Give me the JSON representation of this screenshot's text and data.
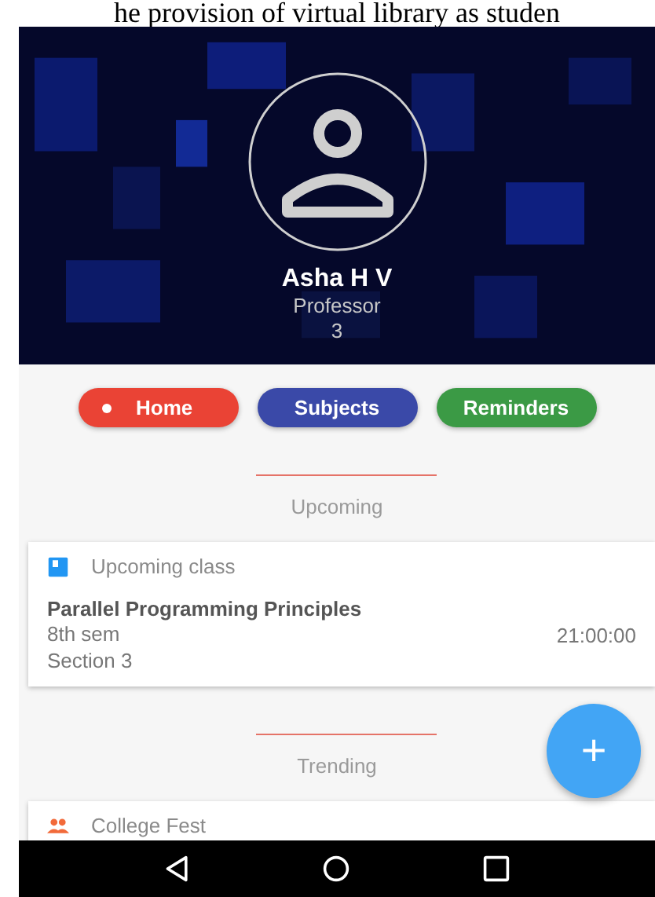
{
  "document": {
    "caption": "he provision of virtual library as studen"
  },
  "profile": {
    "name": "Asha H V",
    "role": "Professor",
    "number": "3"
  },
  "nav_buttons": [
    {
      "label": "Home",
      "selected": true,
      "color": "#ea4335"
    },
    {
      "label": "Subjects",
      "selected": false,
      "color": "#3a49a8"
    },
    {
      "label": "Reminders",
      "selected": false,
      "color": "#3b9a45"
    }
  ],
  "sections": [
    {
      "heading": "Upcoming",
      "cards": [
        {
          "kind": "class",
          "title": "Upcoming class",
          "subject": "Parallel Programming Principles",
          "semester": "8th sem",
          "section": "Section 3",
          "time": "21:00:00"
        }
      ]
    },
    {
      "heading": "Trending",
      "cards": [
        {
          "kind": "event",
          "title": "College Fest"
        }
      ]
    }
  ],
  "fab": {
    "label": "+"
  }
}
